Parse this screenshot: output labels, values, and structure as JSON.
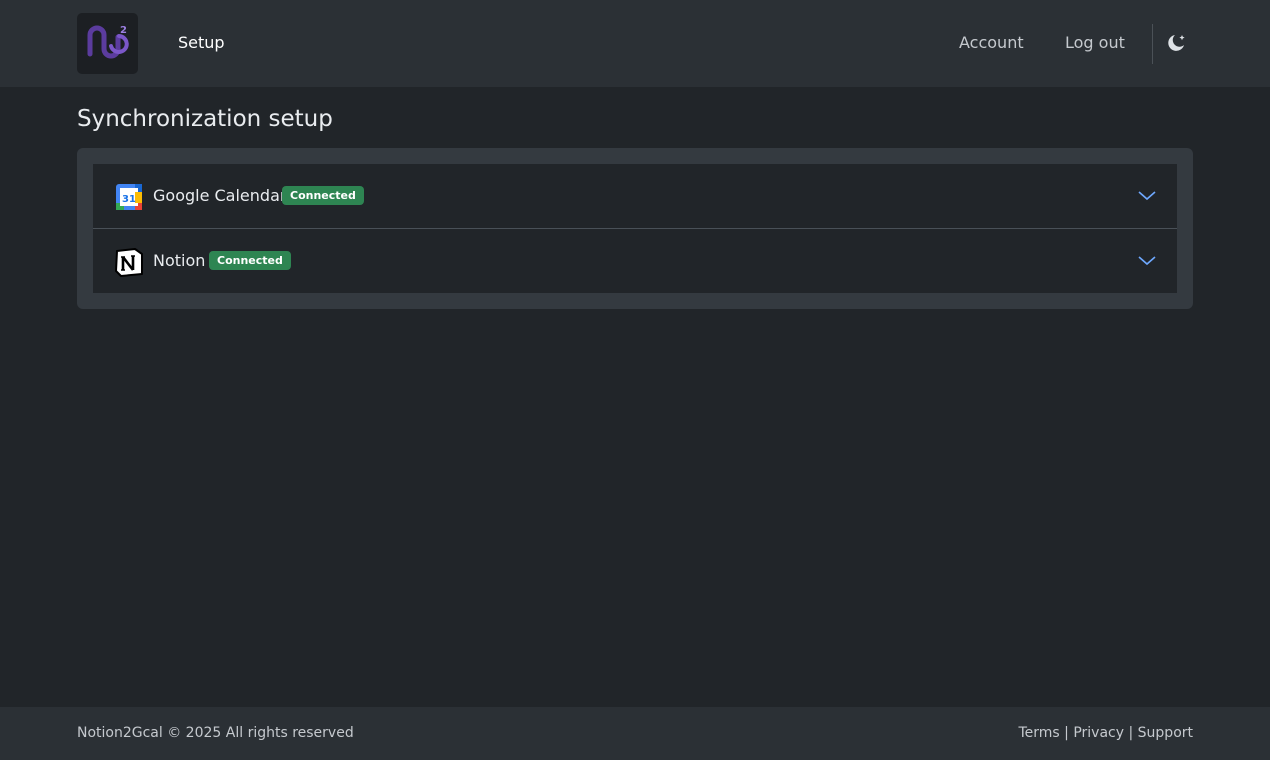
{
  "nav": {
    "brand_icon": "notion2gcal-logo",
    "setup_label": "Setup",
    "account_label": "Account",
    "logout_label": "Log out",
    "theme_icon": "moon-stars-icon"
  },
  "page": {
    "title": "Synchronization setup"
  },
  "integrations": [
    {
      "name": "Google Calendar",
      "status": "Connected",
      "icon": "google-calendar-icon",
      "calendar_day": "31"
    },
    {
      "name": "Notion",
      "status": "Connected",
      "icon": "notion-icon"
    }
  ],
  "footer": {
    "copyright": "Notion2Gcal © 2025 All rights reserved",
    "terms": "Terms",
    "privacy": "Privacy",
    "support": "Support",
    "separator": "|"
  },
  "colors": {
    "badge_success": "#2e8552",
    "accent_purple": "#6f42c1",
    "chevron_blue": "#6ea8fe"
  }
}
